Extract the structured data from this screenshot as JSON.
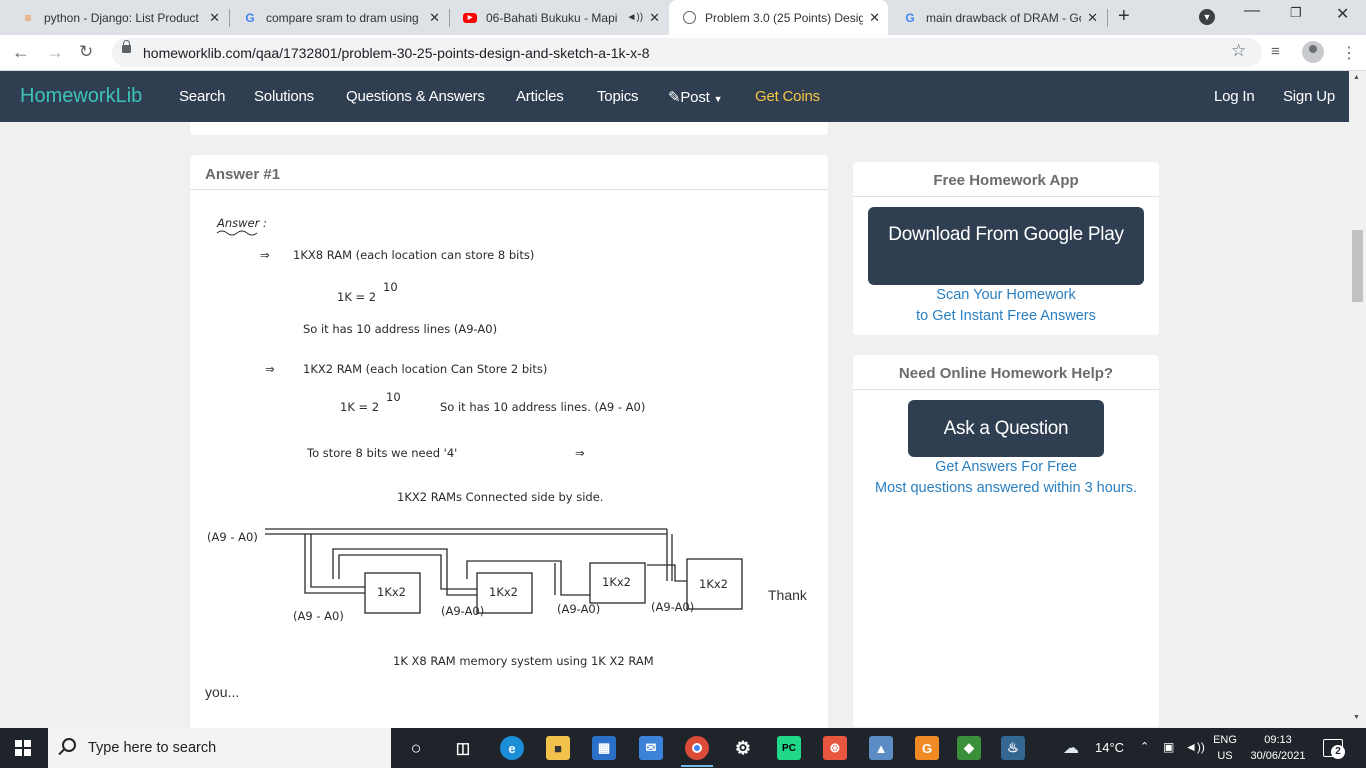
{
  "browser": {
    "tabs": [
      {
        "title": "python - Django: List Product",
        "favicon": "stackoverflow-icon",
        "active": false
      },
      {
        "title": "compare sram to dram using",
        "favicon": "google-icon",
        "active": false
      },
      {
        "title": "06-Bahati Bukuku - Mapi",
        "favicon": "youtube-icon",
        "active": false
      },
      {
        "title": "Problem 3.0 (25 Points) Desig",
        "favicon": "globe-icon",
        "active": true
      },
      {
        "title": "main drawback of DRAM - Go",
        "favicon": "google-icon",
        "active": false
      }
    ],
    "url": "homeworklib.com/qaa/1732801/problem-30-25-points-design-and-sketch-a-1k-x-8"
  },
  "site": {
    "logo": "HomeworkLib",
    "nav": [
      {
        "label": "Search"
      },
      {
        "label": "Solutions"
      },
      {
        "label": "Questions & Answers"
      },
      {
        "label": "Articles"
      },
      {
        "label": "Topics"
      },
      {
        "label": "Post"
      },
      {
        "label": "Get Coins"
      }
    ],
    "login": "Log In",
    "signup": "Sign Up",
    "colors": {
      "nav_bg": "#2f3e50",
      "logo": "#3dc3b5",
      "coins": "#f6c744",
      "link": "#2a7fc1"
    }
  },
  "answer": {
    "heading": "Answer #1",
    "handwriting": {
      "title": "Answer :",
      "l1": "1KX8 RAM (each location can store 8 bits)",
      "l2": "1K = 2",
      "l2sup": "10",
      "l3": "So it has 10 address lines (A9-A0)",
      "l4": "1KX2 RAM (each location Can Store 2 bits)",
      "l5a": "1K = 2",
      "l5sup": "10",
      "l5b": "So it has 10 address lines. (A9 - A0)",
      "l6": "To store 8 bits we need '4'",
      "l7": "1KX2 RAMs Connected side by side.",
      "bus": "(A9 - A0)",
      "chip": "1Kx2",
      "addr_first": "(A9 - A0)",
      "addr": "(A9-A0)",
      "caption": "1K X8 RAM memory system using 1K X2 RAM"
    },
    "thanks": "Thank",
    "you": "you..."
  },
  "sidebar": {
    "app": {
      "title": "Free Homework App",
      "button": "Download From Google Play",
      "line1": "Scan Your Homework",
      "line2": "to Get Instant Free Answers"
    },
    "help": {
      "title": "Need Online Homework Help?",
      "button": "Ask a Question",
      "line1": "Get Answers For Free",
      "line2": "Most questions answered within 3 hours."
    }
  },
  "taskbar": {
    "search_placeholder": "Type here to search",
    "weather": "14°C",
    "lang1": "ENG",
    "lang2": "US",
    "time": "09:13",
    "date": "30/06/2021",
    "notifications": "2"
  }
}
